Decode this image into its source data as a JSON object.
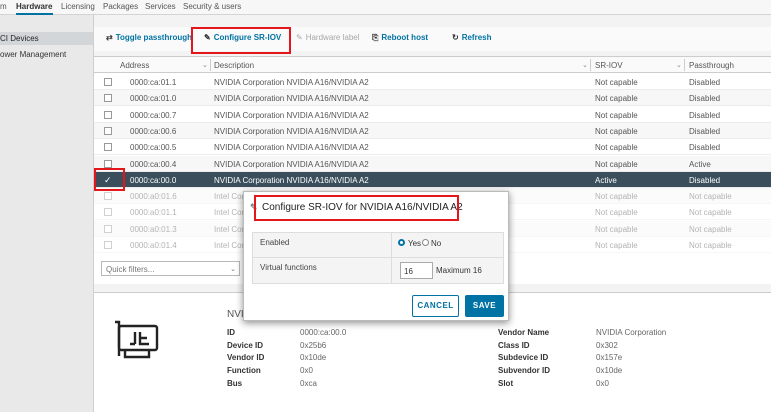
{
  "top_tabs": [
    "m",
    "Hardware",
    "Licensing",
    "Packages",
    "Services",
    "Security & users"
  ],
  "sidebar": {
    "items": [
      "CI Devices",
      "ower Management"
    ]
  },
  "toolbar": {
    "toggle_passthrough": "Toggle passthrough",
    "configure_sriov": "Configure SR-IOV",
    "hardware_label": "Hardware label",
    "reboot_host": "Reboot host",
    "refresh": "Refresh"
  },
  "table": {
    "columns": [
      "Address",
      "Description",
      "SR-IOV",
      "Passthrough"
    ],
    "rows": [
      {
        "address": "0000:ca:01.1",
        "description": "NVIDIA Corporation NVIDIA A16/NVIDIA A2",
        "sriov": "Not capable",
        "passthrough": "Disabled",
        "selected": false
      },
      {
        "address": "0000:ca:01.0",
        "description": "NVIDIA Corporation NVIDIA A16/NVIDIA A2",
        "sriov": "Not capable",
        "passthrough": "Disabled",
        "selected": false
      },
      {
        "address": "0000:ca:00.7",
        "description": "NVIDIA Corporation NVIDIA A16/NVIDIA A2",
        "sriov": "Not capable",
        "passthrough": "Disabled",
        "selected": false
      },
      {
        "address": "0000:ca:00.6",
        "description": "NVIDIA Corporation NVIDIA A16/NVIDIA A2",
        "sriov": "Not capable",
        "passthrough": "Disabled",
        "selected": false
      },
      {
        "address": "0000:ca:00.5",
        "description": "NVIDIA Corporation NVIDIA A16/NVIDIA A2",
        "sriov": "Not capable",
        "passthrough": "Disabled",
        "selected": false
      },
      {
        "address": "0000:ca:00.4",
        "description": "NVIDIA Corporation NVIDIA A16/NVIDIA A2",
        "sriov": "Not capable",
        "passthrough": "Active",
        "selected": false
      },
      {
        "address": "0000:ca:00.0",
        "description": "NVIDIA Corporation NVIDIA A16/NVIDIA A2",
        "sriov": "Active",
        "passthrough": "Disabled",
        "selected": true
      },
      {
        "address": "0000:a0:01.6",
        "description": "Intel Corp",
        "sriov": "Not capable",
        "passthrough": "Not capable",
        "selected": false
      },
      {
        "address": "0000:a0:01.1",
        "description": "Intel Corp",
        "sriov": "Not capable",
        "passthrough": "Not capable",
        "selected": false
      },
      {
        "address": "0000:a0:01.3",
        "description": "Intel Corp",
        "sriov": "Not capable",
        "passthrough": "Not capable",
        "selected": false
      },
      {
        "address": "0000:a0:01.4",
        "description": "Intel Corp",
        "sriov": "Not capable",
        "passthrough": "Not capable",
        "selected": false
      }
    ],
    "selected_check": "✓",
    "filter_placeholder": "Quick filters..."
  },
  "details": {
    "name": "NVIDIA",
    "left": [
      {
        "label": "ID",
        "value": "0000:ca:00.0"
      },
      {
        "label": "Device ID",
        "value": "0x25b6"
      },
      {
        "label": "Vendor ID",
        "value": "0x10de"
      },
      {
        "label": "Function",
        "value": "0x0"
      },
      {
        "label": "Bus",
        "value": "0xca"
      }
    ],
    "right": [
      {
        "label": "Vendor Name",
        "value": "NVIDIA Corporation"
      },
      {
        "label": "Class ID",
        "value": "0x302"
      },
      {
        "label": "Subdevice ID",
        "value": "0x157e"
      },
      {
        "label": "Subvendor ID",
        "value": "0x10de"
      },
      {
        "label": "Slot",
        "value": "0x0"
      }
    ]
  },
  "modal": {
    "title": "Configure SR-IOV for NVIDIA A16/NVIDIA A2",
    "enabled_label": "Enabled",
    "yes_label": "Yes",
    "no_label": "No",
    "enabled_value": "Yes",
    "vf_label": "Virtual functions",
    "vf_value": "16",
    "vf_max": "Maximum 16",
    "cancel": "CANCEL",
    "save": "SAVE"
  },
  "colors": {
    "accent": "#0072a3",
    "highlight": "#e5161b",
    "selected_row": "#3b4e5c"
  }
}
